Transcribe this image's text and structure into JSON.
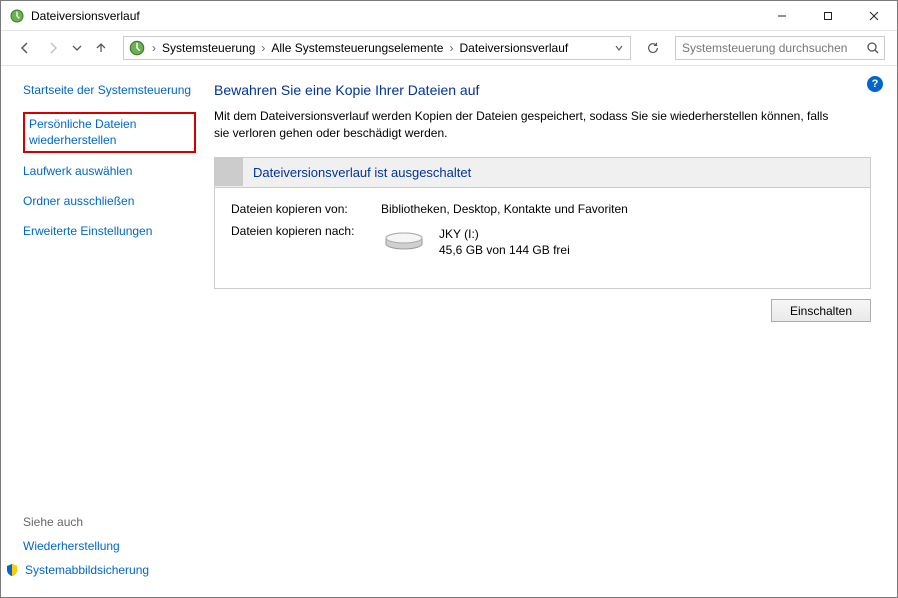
{
  "window": {
    "title": "Dateiversionsverlauf"
  },
  "breadcrumb": {
    "seg1": "Systemsteuerung",
    "seg2": "Alle Systemsteuerungselemente",
    "seg3": "Dateiversionsverlauf"
  },
  "search": {
    "placeholder": "Systemsteuerung durchsuchen"
  },
  "sidebar": {
    "home": "Startseite der Systemsteuerung",
    "restore": "Persönliche Dateien wiederherstellen",
    "select_drive": "Laufwerk auswählen",
    "exclude_folders": "Ordner ausschließen",
    "advanced": "Erweiterte Einstellungen",
    "seealso": "Siehe auch",
    "recovery": "Wiederherstellung",
    "system_image": "Systemabbildsicherung"
  },
  "main": {
    "heading": "Bewahren Sie eine Kopie Ihrer Dateien auf",
    "description": "Mit dem Dateiversionsverlauf werden Kopien der Dateien gespeichert, sodass Sie sie wiederherstellen können, falls sie verloren gehen oder beschädigt werden.",
    "panel_header": "Dateiversionsverlauf ist ausgeschaltet",
    "copy_from_label": "Dateien kopieren von:",
    "copy_from_value": "Bibliotheken, Desktop, Kontakte und Favoriten",
    "copy_to_label": "Dateien kopieren nach:",
    "drive_name": "JKY (I:)",
    "drive_free": "45,6 GB von 144 GB frei",
    "enable_button": "Einschalten"
  }
}
